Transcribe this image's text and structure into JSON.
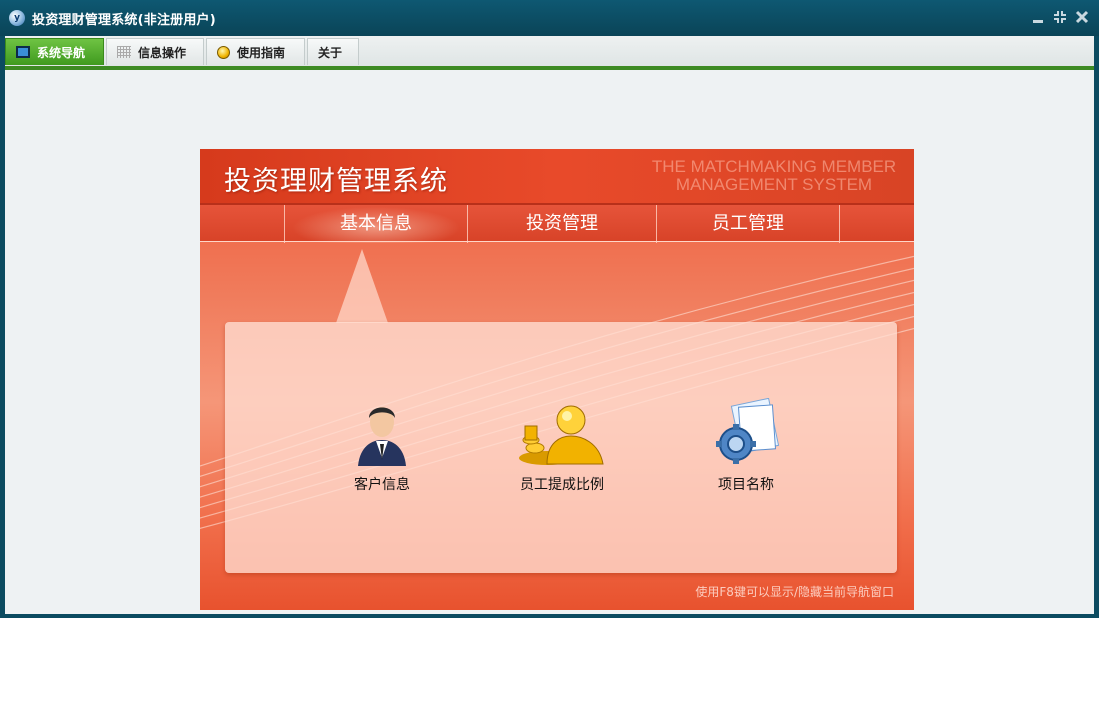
{
  "window": {
    "title": "投资理财管理系统(非注册用户)",
    "app_icon_text": "y"
  },
  "menu": {
    "tabs": [
      {
        "label": "系统导航"
      },
      {
        "label": "信息操作"
      },
      {
        "label": "使用指南"
      },
      {
        "label": "关于"
      }
    ]
  },
  "panel": {
    "title": "投资理财管理系统",
    "subtitle_en_line1": "THE MATCHMAKING MEMBER",
    "subtitle_en_line2": "MANAGEMENT SYSTEM",
    "nav": [
      {
        "label": "基本信息"
      },
      {
        "label": "投资管理"
      },
      {
        "label": "员工管理"
      }
    ],
    "items": [
      {
        "label": "客户信息",
        "icon": "customer-icon"
      },
      {
        "label": "员工提成比例",
        "icon": "commission-icon"
      },
      {
        "label": "项目名称",
        "icon": "project-icon"
      }
    ],
    "hint": "使用F8键可以显示/隐藏当前导航窗口"
  },
  "colors": {
    "titlebar": "#0b4b60",
    "accent_green": "#3d8a23",
    "panel_red": "#e84a2a"
  }
}
